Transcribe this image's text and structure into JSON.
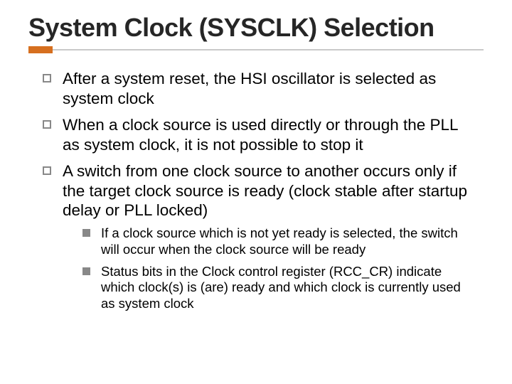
{
  "title": "System Clock (SYSCLK) Selection",
  "bullets": [
    {
      "text": "After a system reset, the HSI oscillator is selected as system clock"
    },
    {
      "text": "When a clock source is used directly or through the PLL as system clock, it is not possible to stop it"
    },
    {
      "text": "A switch from one clock source to another occurs only if the target clock source is ready (clock stable after startup delay or PLL locked)",
      "sub": [
        "If a clock source which is not yet ready is selected, the switch will occur when the clock source will be ready",
        "Status bits in the Clock control register (RCC_CR) indicate which clock(s) is (are) ready and which clock is currently used as system clock"
      ]
    }
  ]
}
